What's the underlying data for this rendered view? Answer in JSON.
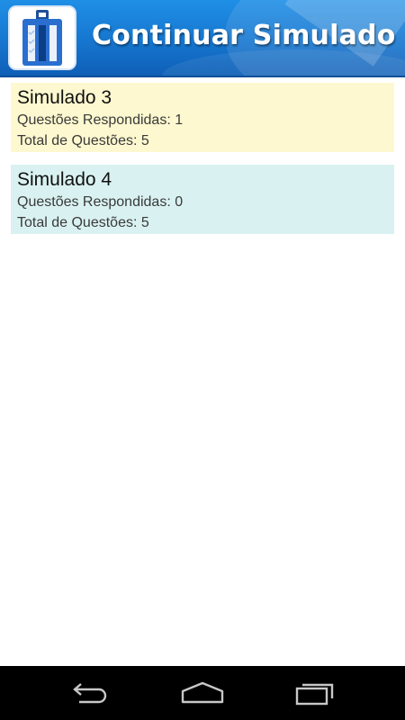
{
  "header": {
    "title": "Continuar Simulado",
    "icon": "clipboard-checklist-icon"
  },
  "simulados": [
    {
      "name": "Simulado 3",
      "answered_label": "Questões Respondidas: 1",
      "total_label": "Total de Questões: 5",
      "color": "#fdf8cf"
    },
    {
      "name": "Simulado 4",
      "answered_label": "Questões Respondidas: 0",
      "total_label": "Total de Questões: 5",
      "color": "#d9f2f1"
    }
  ],
  "navbar": {
    "back_icon": "back-arrow-icon",
    "home_icon": "home-icon",
    "recents_icon": "recent-apps-icon"
  },
  "colors": {
    "header_blue": "#1676cf",
    "nav_background": "#000000"
  }
}
